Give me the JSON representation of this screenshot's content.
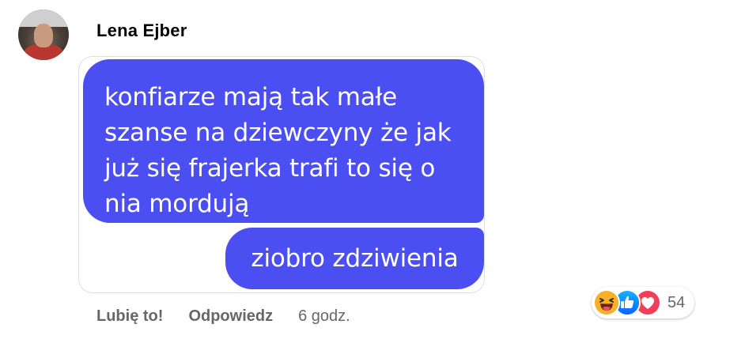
{
  "comment": {
    "author": "Lena Ejber",
    "messages": [
      "konfiarze mają tak małe\nszanse na dziewczyny że jak\njuż się frajerka trafi to się o\nnia mordują",
      "ziobro zdziwienia"
    ],
    "actions": {
      "like_label": "Lubię to!",
      "reply_label": "Odpowiedz",
      "timestamp": "6 godz."
    },
    "reactions": {
      "icons": [
        "haha-icon",
        "like-icon",
        "love-icon"
      ],
      "count": "54"
    },
    "colors": {
      "bubble": "#4b4ef0",
      "action_text": "#65676b",
      "like_blue": "#1877f2",
      "love_red": "#f33e58",
      "haha_yellow": "#f7b125"
    }
  }
}
